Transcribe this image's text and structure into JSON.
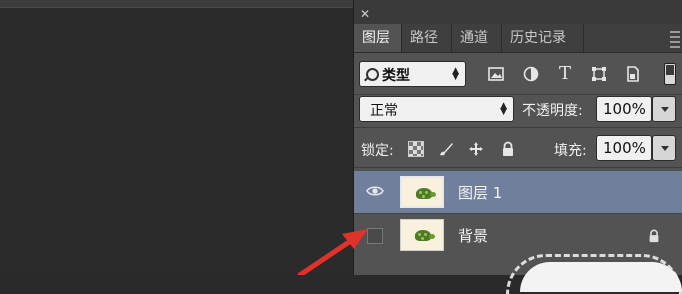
{
  "panel": {
    "tabs": [
      {
        "label": "图层",
        "active": true
      },
      {
        "label": "路径",
        "active": false
      },
      {
        "label": "通道",
        "active": false
      },
      {
        "label": "历史记录",
        "active": false
      }
    ],
    "filter": {
      "kind_label": "类型"
    },
    "blend_mode": "正常",
    "opacity": {
      "label": "不透明度:",
      "value": "100%"
    },
    "lock": {
      "label": "锁定:"
    },
    "fill": {
      "label": "填充:",
      "value": "100%"
    },
    "layers": [
      {
        "name": "图层 1",
        "visible": true,
        "selected": true
      },
      {
        "name": "背景",
        "visible": false,
        "selected": false,
        "locked": true
      }
    ]
  },
  "colors": {
    "selected_row": "#6f7f9c",
    "panel_bg": "#535353",
    "arrow": "#e0322b"
  },
  "icons": [
    "close-icon",
    "search-icon",
    "image-filter-icon",
    "adjustment-filter-icon",
    "type-filter-icon",
    "shape-filter-icon",
    "smart-object-filter-icon",
    "eye-icon",
    "lock-icon"
  ]
}
